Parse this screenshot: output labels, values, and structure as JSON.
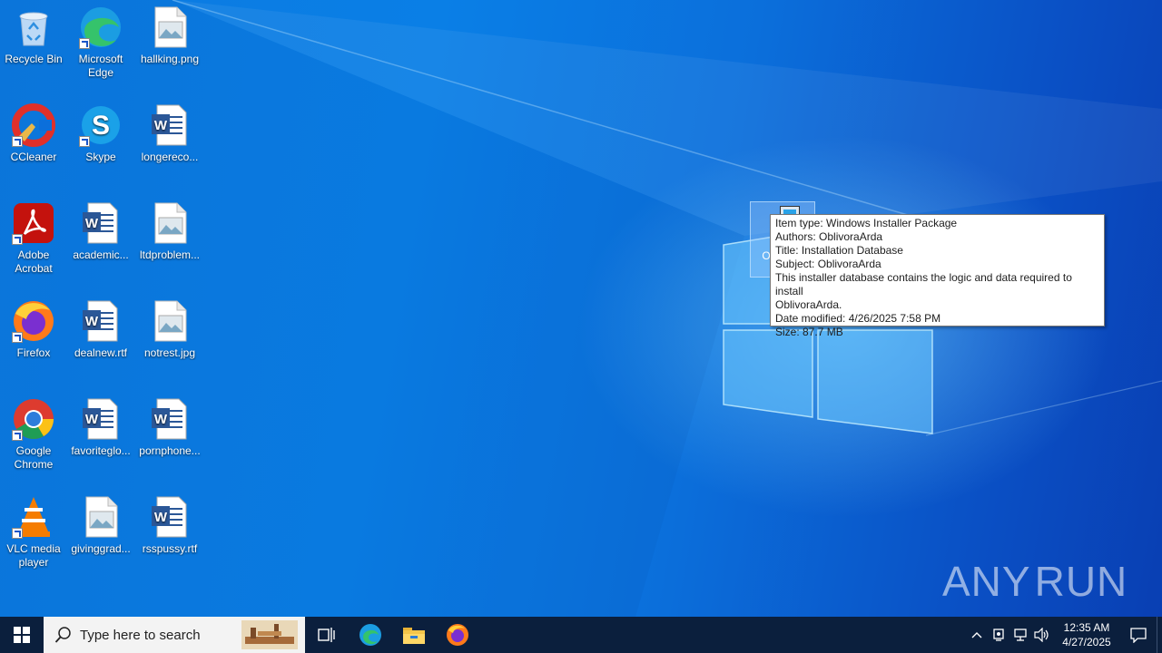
{
  "desktop": {
    "icons": [
      {
        "id": "recycle-bin",
        "label": "Recycle Bin",
        "icon": "recycle-bin-icon",
        "shortcut": false
      },
      {
        "id": "microsoft-edge",
        "label": "Microsoft Edge",
        "icon": "edge-icon",
        "shortcut": true
      },
      {
        "id": "hallking",
        "label": "hallking.png",
        "icon": "image-file-icon",
        "shortcut": false
      },
      {
        "id": "ccleaner",
        "label": "CCleaner",
        "icon": "ccleaner-icon",
        "shortcut": true
      },
      {
        "id": "skype",
        "label": "Skype",
        "icon": "skype-icon",
        "shortcut": true
      },
      {
        "id": "longereco",
        "label": "longereco...",
        "icon": "word-doc-icon",
        "shortcut": false
      },
      {
        "id": "adobe-acrobat",
        "label": "Adobe Acrobat",
        "icon": "acrobat-icon",
        "shortcut": true
      },
      {
        "id": "academic",
        "label": "academic...",
        "icon": "word-doc-icon",
        "shortcut": false
      },
      {
        "id": "ltdproblem",
        "label": "ltdproblem...",
        "icon": "image-file-icon",
        "shortcut": false
      },
      {
        "id": "firefox",
        "label": "Firefox",
        "icon": "firefox-icon",
        "shortcut": true
      },
      {
        "id": "dealnew",
        "label": "dealnew.rtf",
        "icon": "word-doc-icon",
        "shortcut": false
      },
      {
        "id": "notrest",
        "label": "notrest.jpg",
        "icon": "image-file-icon",
        "shortcut": false
      },
      {
        "id": "google-chrome",
        "label": "Google Chrome",
        "icon": "chrome-icon",
        "shortcut": true
      },
      {
        "id": "favoriteglo",
        "label": "favoriteglo...",
        "icon": "word-doc-icon",
        "shortcut": false
      },
      {
        "id": "pornphone",
        "label": "pornphone...",
        "icon": "word-doc-icon",
        "shortcut": false
      },
      {
        "id": "vlc",
        "label": "VLC media player",
        "icon": "vlc-icon",
        "shortcut": true
      },
      {
        "id": "givinggrad",
        "label": "givinggrad...",
        "icon": "image-file-icon",
        "shortcut": false
      },
      {
        "id": "rsspussy",
        "label": "rsspussy.rtf",
        "icon": "word-doc-icon",
        "shortcut": false
      }
    ],
    "selected_file": {
      "label": "O... Se...",
      "icon": "installer-icon"
    }
  },
  "tooltip": {
    "item_type": "Item type: Windows Installer Package",
    "authors": "Authors: OblivoraArda",
    "title": "Title: Installation Database",
    "subject": "Subject: OblivoraArda",
    "comments_line1": "This installer database contains the logic and data required to install",
    "comments_line2": "OblivoraArda.",
    "date_modified": "Date modified: 4/26/2025 7:58 PM",
    "size": "Size: 87.7 MB"
  },
  "watermark": {
    "left": "ANY",
    "right": "RUN"
  },
  "taskbar": {
    "search_placeholder": "Type here to search",
    "pinned": [
      "task-view-icon",
      "edge-icon",
      "file-explorer-icon",
      "firefox-icon"
    ],
    "clock_time": "12:35 AM",
    "clock_date": "4/27/2025"
  }
}
